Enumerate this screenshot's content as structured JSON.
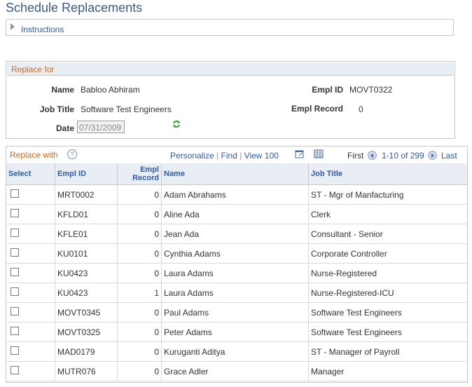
{
  "page": {
    "title": "Schedule Replacements"
  },
  "instructions": {
    "label": "Instructions"
  },
  "replace_for": {
    "header": "Replace for",
    "name_label": "Name",
    "name_value": "Babloo Abhiram",
    "job_title_label": "Job Title",
    "job_title_value": "Software Test Engineers",
    "date_label": "Date",
    "date_value": "07/31/2009",
    "emplid_label": "Empl ID",
    "emplid_value": "MOVT0322",
    "emplrec_label": "Empl Record",
    "emplrec_value": "0"
  },
  "replace_with": {
    "header": "Replace with",
    "help": "?",
    "personalize": "Personalize",
    "find": "Find",
    "view": "View 100",
    "first": "First",
    "range": "1-10 of 299",
    "last": "Last",
    "sep": "|",
    "columns": {
      "select": "Select",
      "emplid": "Empl ID",
      "emplrec_1": "Empl",
      "emplrec_2": "Record",
      "name": "Name",
      "jobtitle": "Job Title"
    },
    "rows": [
      {
        "emplid": "MRT0002",
        "rec": "0",
        "name": "Adam Abrahams",
        "job": "ST - Mgr of Manfacturing"
      },
      {
        "emplid": "KFLD01",
        "rec": "0",
        "name": "Aline Ada",
        "job": "Clerk"
      },
      {
        "emplid": "KFLE01",
        "rec": "0",
        "name": "Jean Ada",
        "job": "Consultant - Senior"
      },
      {
        "emplid": "KU0101",
        "rec": "0",
        "name": "Cynthia Adams",
        "job": "Corporate Controller"
      },
      {
        "emplid": "KU0423",
        "rec": "0",
        "name": "Laura Adams",
        "job": "Nurse-Registered"
      },
      {
        "emplid": "KU0423",
        "rec": "1",
        "name": "Laura Adams",
        "job": "Nurse-Registered-ICU"
      },
      {
        "emplid": "MOVT0345",
        "rec": "0",
        "name": "Paul Adams",
        "job": "Software Test Engineers"
      },
      {
        "emplid": "MOVT0325",
        "rec": "0",
        "name": "Peter Adams",
        "job": "Software Test Engineers"
      },
      {
        "emplid": "MAD0179",
        "rec": "0",
        "name": "Kuruganti Aditya",
        "job": "ST - Manager of Payroll"
      },
      {
        "emplid": "MUTR076",
        "rec": "0",
        "name": "Grace Adler",
        "job": "Manager"
      }
    ]
  },
  "colors": {
    "title": "#3d5a8c",
    "section_header": "#d26a1c",
    "link": "#2e5aac",
    "header_bg": "#e8eef4"
  }
}
